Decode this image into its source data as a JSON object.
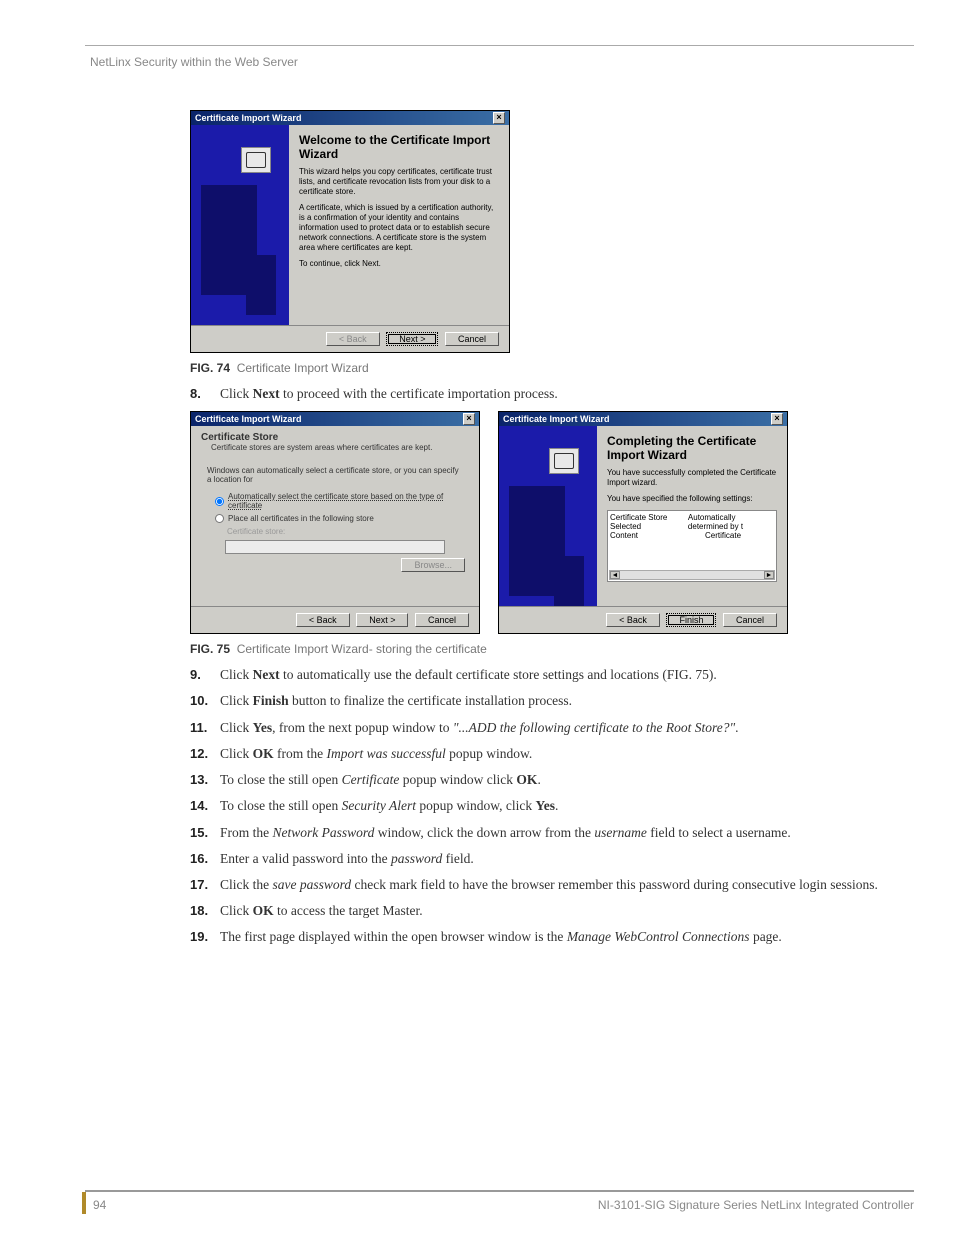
{
  "header": "NetLinx Security within the Web Server",
  "footer_page": "94",
  "footer_doc": "NI-3101-SIG Signature Series NetLinx Integrated Controller",
  "fig74": {
    "title": "Certificate Import Wizard",
    "heading": "Welcome to the Certificate Import Wizard",
    "p1": "This wizard helps you copy certificates, certificate trust lists, and certificate revocation lists from your disk to a certificate store.",
    "p2": "A certificate, which is issued by a certification authority, is a confirmation of your identity and contains information used to protect data or to establish secure network connections. A certificate store is the system area where certificates are kept.",
    "p3": "To continue, click Next.",
    "back": "< Back",
    "next": "Next >",
    "cancel": "Cancel",
    "caption_label": "FIG. 74",
    "caption_text": "Certificate Import Wizard"
  },
  "steps_a": {
    "s8_num": "8.",
    "s8_pre": "Click ",
    "s8_b": "Next",
    "s8_post": " to proceed with the certificate importation process."
  },
  "fig75a": {
    "title": "Certificate Import Wizard",
    "section": "Certificate Store",
    "sub": "Certificate stores are system areas where certificates are kept.",
    "instr": "Windows can automatically select a certificate store, or you can specify a location for",
    "opt1": "Automatically select the certificate store based on the type of certificate",
    "opt2": "Place all certificates in the following store",
    "label": "Certificate store:",
    "browse": "Browse...",
    "back": "< Back",
    "next": "Next >",
    "cancel": "Cancel"
  },
  "fig75b": {
    "title": "Certificate Import Wizard",
    "heading": "Completing the Certificate Import Wizard",
    "p1": "You have successfully completed the Certificate Import wizard.",
    "p2": "You have specified the following settings:",
    "row1a": "Certificate Store Selected",
    "row1b": "Automatically determined by t",
    "row2a": "Content",
    "row2b": "Certificate",
    "back": "< Back",
    "finish": "Finish",
    "cancel": "Cancel"
  },
  "fig75": {
    "caption_label": "FIG. 75",
    "caption_text": "Certificate Import Wizard- storing the certificate"
  },
  "steps_b": {
    "s9_num": "9.",
    "s9_pre": "Click ",
    "s9_b": "Next",
    "s9_post": " to automatically use the default certificate store settings and locations (FIG. 75).",
    "s10_num": "10.",
    "s10_pre": "Click ",
    "s10_b": "Finish",
    "s10_post": " button to finalize the certificate installation process.",
    "s11_num": "11.",
    "s11_pre": "Click ",
    "s11_b": "Yes",
    "s11_mid": ", from the next popup window to ",
    "s11_i": "\"...ADD the following certificate to the Root Store?\"",
    "s11_post": ".",
    "s12_num": "12.",
    "s12_pre": "Click ",
    "s12_b": "OK",
    "s12_mid": " from the ",
    "s12_i": "Import was successful",
    "s12_post": " popup window.",
    "s13_num": "13.",
    "s13_pre": "To close the still open ",
    "s13_i": "Certificate",
    "s13_mid": " popup window click ",
    "s13_b": "OK",
    "s13_post": ".",
    "s14_num": "14.",
    "s14_pre": "To close the still open ",
    "s14_i": "Security Alert",
    "s14_mid": " popup window, click ",
    "s14_b": "Yes",
    "s14_post": ".",
    "s15_num": "15.",
    "s15_pre": "From the ",
    "s15_i1": "Network Password",
    "s15_mid": " window, click the down arrow from the ",
    "s15_i2": "username",
    "s15_post": " field to select a username.",
    "s16_num": "16.",
    "s16_pre": "Enter a valid password into the ",
    "s16_i": "password",
    "s16_post": " field.",
    "s17_num": "17.",
    "s17_pre": "Click the ",
    "s17_i": "save password",
    "s17_post": " check mark field to have the browser remember this password during consecutive login sessions.",
    "s18_num": "18.",
    "s18_pre": "Click ",
    "s18_b": "OK",
    "s18_post": " to access the target Master.",
    "s19_num": "19.",
    "s19_pre": "The first page displayed within the open browser window is the ",
    "s19_i": "Manage WebControl Connections",
    "s19_post": " page."
  }
}
